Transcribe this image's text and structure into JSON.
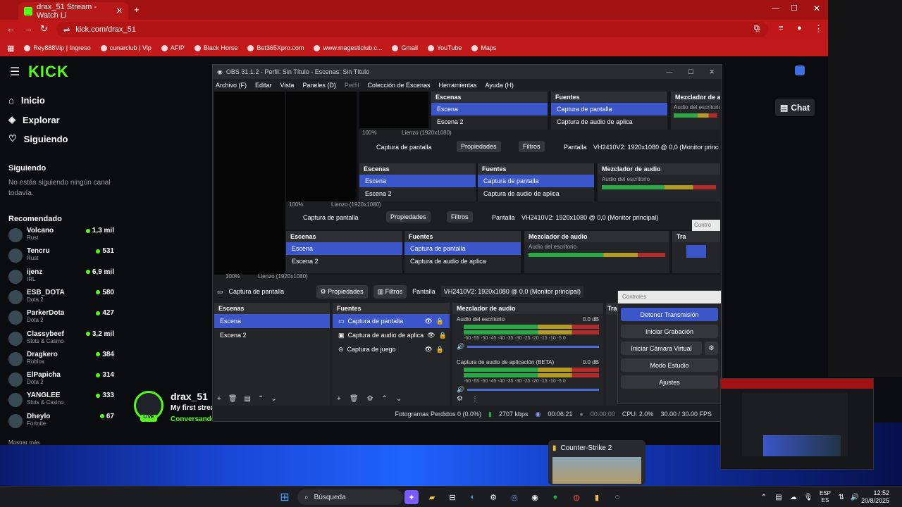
{
  "browser": {
    "tab_title": "drax_51 Stream - Watch Li",
    "url": "kick.com/drax_51",
    "bookmarks": [
      "Rey888Vip | Ingreso",
      "cunarclub | Vip",
      "AFIP",
      "Black Horse",
      "Bet365Xpro.com",
      "www.magesticlub.c...",
      "Gmail",
      "YouTube",
      "Maps"
    ]
  },
  "kick": {
    "logo": "KICK",
    "nav": [
      "Inicio",
      "Explorar",
      "Siguiendo"
    ],
    "following_title": "Siguiendo",
    "following_empty": "No estás siguiendo ningún canal todavía.",
    "recommended_title": "Recomendado",
    "recommended": [
      {
        "name": "Volcano",
        "cat": "Rust",
        "count": "1,3 mil"
      },
      {
        "name": "Tencru",
        "cat": "Rust",
        "count": "531"
      },
      {
        "name": "ijenz",
        "cat": "IRL",
        "count": "6,9 mil"
      },
      {
        "name": "ESB_DOTA",
        "cat": "Dota 2",
        "count": "580"
      },
      {
        "name": "ParkerDota",
        "cat": "Dota 2",
        "count": "427"
      },
      {
        "name": "Classybeef",
        "cat": "Slots & Casino",
        "count": "3,2 mil"
      },
      {
        "name": "Dragkero",
        "cat": "Roblox",
        "count": "384"
      },
      {
        "name": "ElPapicha",
        "cat": "Dota 2",
        "count": "314"
      },
      {
        "name": "YANGLEE",
        "cat": "Slots & Casino",
        "count": "333"
      },
      {
        "name": "Dheylo",
        "cat": "Fortnite",
        "count": "67"
      }
    ],
    "chat_label": "Chat",
    "streamer": "drax_51",
    "stream_title": "My first strea",
    "status": "Conversando",
    "live": "LIVE"
  },
  "obs": {
    "title": "OBS 31.1.2 - Perfil: Sin Título - Escenas: Sin Título",
    "menu": [
      "Archivo (F)",
      "Editar",
      "Vista",
      "Paneles (D)",
      "Perfil",
      "Colección de Escenas",
      "Herramientas",
      "Ayuda (H)"
    ],
    "canvas": "Lienzo (1920x1080)",
    "zoom": "100%",
    "source_bar": {
      "source": "Captura de pantalla",
      "props": "Propiedades",
      "filters": "Filtros",
      "display_label": "Pantalla",
      "display": "VH2410V2: 1920x1080 @ 0,0 (Monitor principal)"
    },
    "scenes_title": "Escenas",
    "scenes": [
      "Escena",
      "Escena 2"
    ],
    "sources_title": "Fuentes",
    "sources": [
      "Captura de pantalla",
      "Captura de audio de aplica",
      "Captura de juego"
    ],
    "mixer_title": "Mezclador de audio",
    "mixer": [
      {
        "name": "Audio del escritorio",
        "db": "0.0 dB"
      },
      {
        "name": "Captura de audio de aplicación (BETA)",
        "db": "0.0 dB"
      }
    ],
    "scale": "-60 -55 -50 -45 -40 -35 -30 -25 -20 -15 -10 -5 0",
    "controls_title": "Controles",
    "controls": [
      "Detener Transmisión",
      "Iniciar Grabación",
      "Iniciar Cámara Virtual",
      "Modo Estudio",
      "Ajustes"
    ],
    "status": {
      "dropped": "Fotogramas Perdidos 0 (0.0%)",
      "kbps": "2707 kbps",
      "stream_time": "00:06:21",
      "rec_time": "00:00:00",
      "cpu": "CPU: 2.0%",
      "fps": "30.00 / 30.00 FPS"
    },
    "tra": "Tra",
    "controls_short": "Contro"
  },
  "taskbar": {
    "search": "Búsqueda",
    "popup": "Counter-Strike 2",
    "lang": "ESP",
    "region": "ES",
    "time": "12:52",
    "date": "20/8/2025"
  }
}
